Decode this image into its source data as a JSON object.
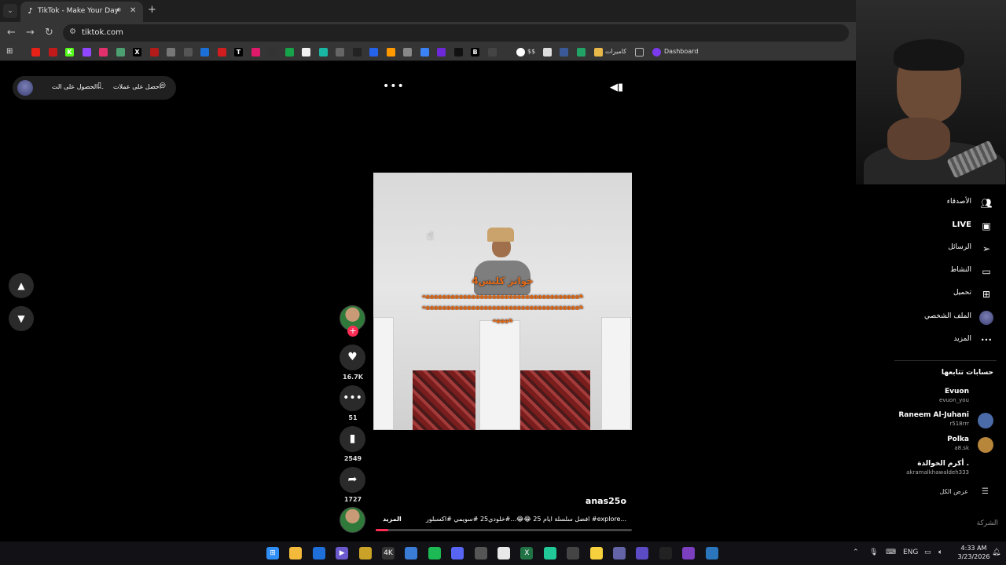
{
  "browser": {
    "tab_title": "TikTok - Make Your Day",
    "url": "tiktok.com",
    "bookmarks": [
      {
        "icon": "youtube-icon",
        "color": "#e62117"
      },
      {
        "icon": "red-icon",
        "color": "#c21a1a"
      },
      {
        "icon": "kick-icon",
        "color": "#53fc18",
        "text": "K"
      },
      {
        "icon": "twitch-icon",
        "color": "#9146ff"
      },
      {
        "icon": "instagram-icon",
        "color": "#e1306c"
      },
      {
        "icon": "green-icon",
        "color": "#4c9f70"
      },
      {
        "icon": "x-icon",
        "color": "#000000",
        "text": "X"
      },
      {
        "icon": "red-icon-2",
        "color": "#b31a1a"
      },
      {
        "icon": "gray-icon",
        "color": "#777777"
      },
      {
        "icon": "link-icon",
        "color": "#555555"
      },
      {
        "icon": "blue-icon",
        "color": "#1d6fd8"
      },
      {
        "icon": "red-pin-icon",
        "color": "#d11d1d"
      },
      {
        "icon": "t-icon",
        "color": "#000000",
        "text": "T"
      },
      {
        "icon": "pink-icon",
        "color": "#e01a6b"
      },
      {
        "icon": "chrome-like-icon",
        "color": "#333333"
      },
      {
        "icon": "green-circle-icon",
        "color": "#16a34a"
      },
      {
        "icon": "doc-icon",
        "color": "#f1f1f1"
      },
      {
        "icon": "teal-icon",
        "color": "#18b6a3"
      },
      {
        "icon": "gray-icon-2",
        "color": "#666666"
      },
      {
        "icon": "dark-icon",
        "color": "#222222"
      },
      {
        "icon": "blue-icon-2",
        "color": "#2563eb"
      },
      {
        "icon": "amazon-icon",
        "color": "#ff9900"
      },
      {
        "icon": "bag-icon",
        "color": "#888888"
      },
      {
        "icon": "blue-icon-3",
        "color": "#3b82f6"
      },
      {
        "icon": "purple-icon",
        "color": "#6d28d9"
      },
      {
        "icon": "black-icon",
        "color": "#111111"
      },
      {
        "icon": "b-icon",
        "color": "#000000",
        "text": "B"
      },
      {
        "icon": "dots-icon",
        "color": "#444444"
      }
    ],
    "bookmark_labels": {
      "google_dollar": "$$",
      "cameras": "كاميرات",
      "dashboard": "Dashboard"
    }
  },
  "page": {
    "top_links": {
      "get_coins": "احصل على عملات",
      "get_app": "الحصول على الت..."
    },
    "video": {
      "caption_line1": "خوانز كلبس4",
      "caption_line2": "ههههههههههههههههههههههههههههههههههههههه",
      "caption_line3": "ههههههههههههههههههههههههههههههههههههههه",
      "caption_line4": "ههههه"
    },
    "actions": {
      "likes": "16.7K",
      "comments": "51",
      "saves": "2549",
      "shares": "1727"
    },
    "post": {
      "author": "anas25o",
      "description": "افضل سلسلة ايام 25 😂😂...#خلودي25 #سويمي #اكسبلور #explore...",
      "more": "المزيد",
      "progress": 0.05
    }
  },
  "sidebar": {
    "items": [
      {
        "label": "الأصدقاء",
        "icon": "friends-icon"
      },
      {
        "label": "LIVE",
        "icon": "live-icon"
      },
      {
        "label": "الرسائل",
        "icon": "messages-icon"
      },
      {
        "label": "النشاط",
        "icon": "activity-icon"
      },
      {
        "label": "تحميل",
        "icon": "upload-icon"
      },
      {
        "label": "الملف الشخصي",
        "icon": "profile-avatar"
      },
      {
        "label": "المزيد",
        "icon": "more-icon"
      }
    ],
    "following_heading": "حسابات تتابعها",
    "accounts": [
      {
        "name": "Evuon",
        "handle": "evuon_you"
      },
      {
        "name": "Raneem Al-Juhani",
        "handle": "r518rrr"
      },
      {
        "name": "Polka",
        "handle": "a8.sk"
      },
      {
        "name": "أكرم الخوالدة .",
        "handle": "akramalkhawaldeh333"
      }
    ],
    "see_all": "عرض الكل",
    "company": "الشركة"
  },
  "taskbar": {
    "lang": "ENG",
    "time": "4:33 AM",
    "date": "3/23/2026"
  }
}
